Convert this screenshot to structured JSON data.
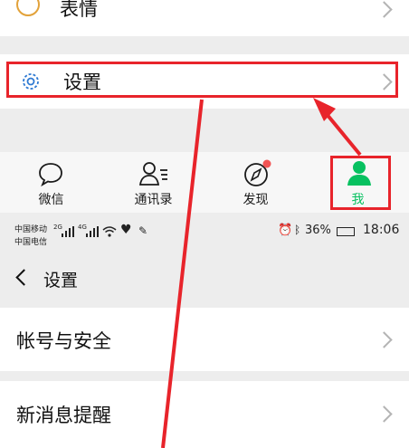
{
  "top_menu": {
    "emoji_label": "表情",
    "settings_label": "设置"
  },
  "tabbar": {
    "tabs": [
      {
        "label": "微信"
      },
      {
        "label": "通讯录"
      },
      {
        "label": "发现"
      },
      {
        "label": "我"
      }
    ]
  },
  "statusbar": {
    "carrier1": "中国移动",
    "carrier2": "中国电信",
    "net1": "2G",
    "net2": "4G",
    "battery": "36%",
    "time": "18:06"
  },
  "settings_page": {
    "title": "设置",
    "items": [
      {
        "label": "帐号与安全"
      },
      {
        "label": "新消息提醒"
      }
    ]
  },
  "colors": {
    "accent_green": "#07c160",
    "highlight_red": "#e8242b",
    "icon_blue": "#2f7ad3"
  }
}
